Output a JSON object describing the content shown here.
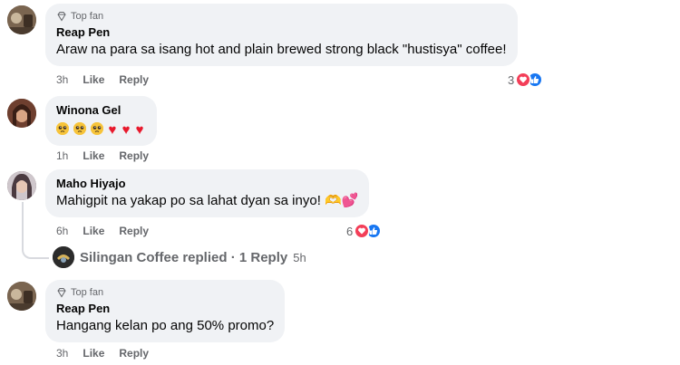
{
  "comments": [
    {
      "badge": "Top fan",
      "author": "Reap Pen",
      "text": "Araw na para sa isang hot and plain brewed strong black \"hustisya\" coffee!",
      "time": "3h",
      "like": "Like",
      "reply": "Reply",
      "reaction_count": "3"
    },
    {
      "badge": "",
      "author": "Winona Gel",
      "text": "",
      "emoji_sequence": [
        "pleading-face",
        "pleading-face",
        "pleading-face",
        "red-heart",
        "red-heart",
        "red-heart"
      ],
      "time": "1h",
      "like": "Like",
      "reply": "Reply",
      "reaction_count": ""
    },
    {
      "badge": "",
      "author": "Maho Hiyajo",
      "text": "Mahigpit na yakap po sa lahat dyan sa inyo! 🫶💕",
      "time": "6h",
      "like": "Like",
      "reply": "Reply",
      "reaction_count": "6"
    },
    {
      "badge": "Top fan",
      "author": "Reap Pen",
      "text": "Hangang kelan po ang 50% promo?",
      "time": "3h",
      "like": "Like",
      "reply": "Reply",
      "reaction_count": ""
    }
  ],
  "replies_summary": {
    "page_name": "Silingan Coffee",
    "label": "Silingan Coffee replied · 1 Reply",
    "time": "5h"
  },
  "colors": {
    "bubble": "#f0f2f5",
    "meta_text": "#65676b",
    "love": "#f33e58",
    "like": "#1877f2"
  }
}
